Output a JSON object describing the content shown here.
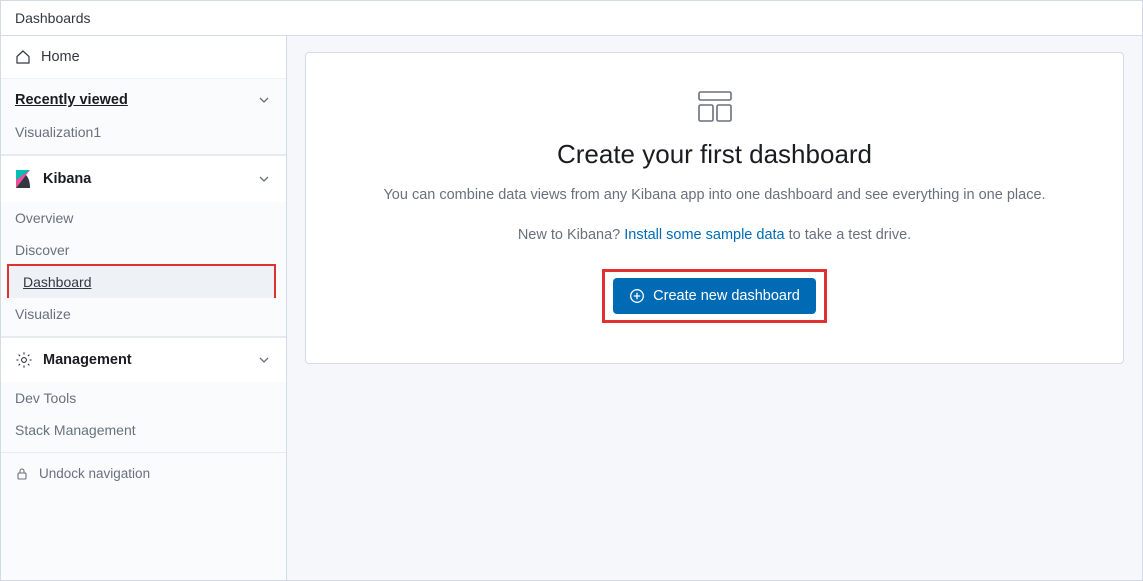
{
  "topbar": {
    "breadcrumb": "Dashboards"
  },
  "sidebar": {
    "home_label": "Home",
    "recently_viewed": {
      "title": "Recently viewed",
      "items": [
        "Visualization1"
      ]
    },
    "kibana": {
      "title": "Kibana",
      "items": [
        "Overview",
        "Discover",
        "Dashboard",
        "Visualize"
      ],
      "active_index": 2
    },
    "management": {
      "title": "Management",
      "items": [
        "Dev Tools",
        "Stack Management"
      ]
    },
    "undock_label": "Undock navigation"
  },
  "main": {
    "heading": "Create your first dashboard",
    "description": "You can combine data views from any Kibana app into one dashboard and see everything in one place.",
    "prompt_prefix": "New to Kibana? ",
    "prompt_link": "Install some sample data",
    "prompt_suffix": " to take a test drive.",
    "button_label": "Create new dashboard"
  }
}
